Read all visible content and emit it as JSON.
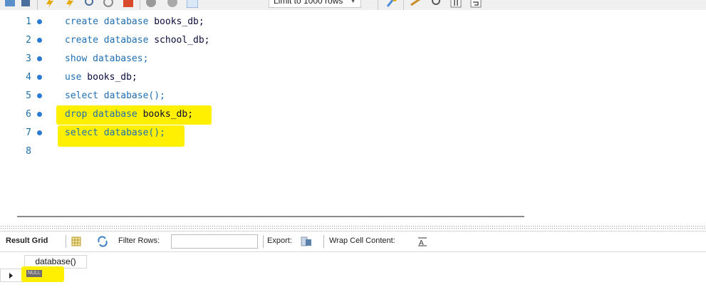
{
  "toolbar": {
    "limit_label": "Limit to 1000 rows",
    "icons": [
      "folder-icon",
      "save-icon",
      "execute-icon",
      "execute-current-icon",
      "explain-icon",
      "stop-icon",
      "toggle-icon",
      "commit-icon",
      "rollback-icon",
      "autocommit-icon",
      "beautify-icon",
      "find-icon",
      "invisible-chars-icon",
      "wrap-icon"
    ]
  },
  "editor": {
    "lines": [
      {
        "number": "1",
        "kw": "create database",
        "rest": " books_db;",
        "dot": true
      },
      {
        "number": "2",
        "kw": "create database",
        "rest": " school_db;",
        "dot": true
      },
      {
        "number": "3",
        "kw": "show databases;",
        "rest": "",
        "dot": true
      },
      {
        "number": "4",
        "kw": "use",
        "rest": " books_db;",
        "dot": true
      },
      {
        "number": "5",
        "kw": "select database();",
        "rest": "",
        "dot": true
      },
      {
        "number": "6",
        "kw": "drop database",
        "rest": " books_db;",
        "dot": true
      },
      {
        "number": "7",
        "kw": "select database();",
        "rest": "",
        "dot": true
      },
      {
        "number": "8",
        "kw": "",
        "rest": "",
        "dot": false
      }
    ],
    "highlight_color": "#ffef00"
  },
  "results": {
    "result_grid_label": "Result Grid",
    "filter_rows_label": "Filter Rows:",
    "filter_value": "",
    "export_label": "Export:",
    "wrap_label": "Wrap Cell Content:",
    "column_header": "database()",
    "cell_value": "NULL"
  }
}
